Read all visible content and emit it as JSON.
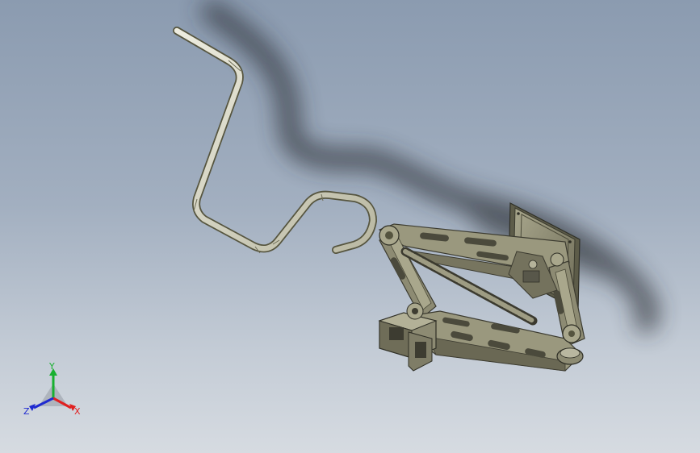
{
  "model": {
    "parts": [
      "jack-handle",
      "scissor-jack"
    ],
    "colors": {
      "background_top": "#8b9bb0",
      "background_bottom": "#d6dbe1",
      "metal_light": "#c7c5aa",
      "metal_mid": "#8d8b73",
      "metal_dark": "#4b4a3c",
      "shadow": "#2c3038"
    }
  },
  "triad": {
    "x_label": "X",
    "y_label": "Y",
    "z_label": "Z",
    "x_color": "#e02020",
    "y_color": "#18b030",
    "z_color": "#1f2ad0"
  }
}
